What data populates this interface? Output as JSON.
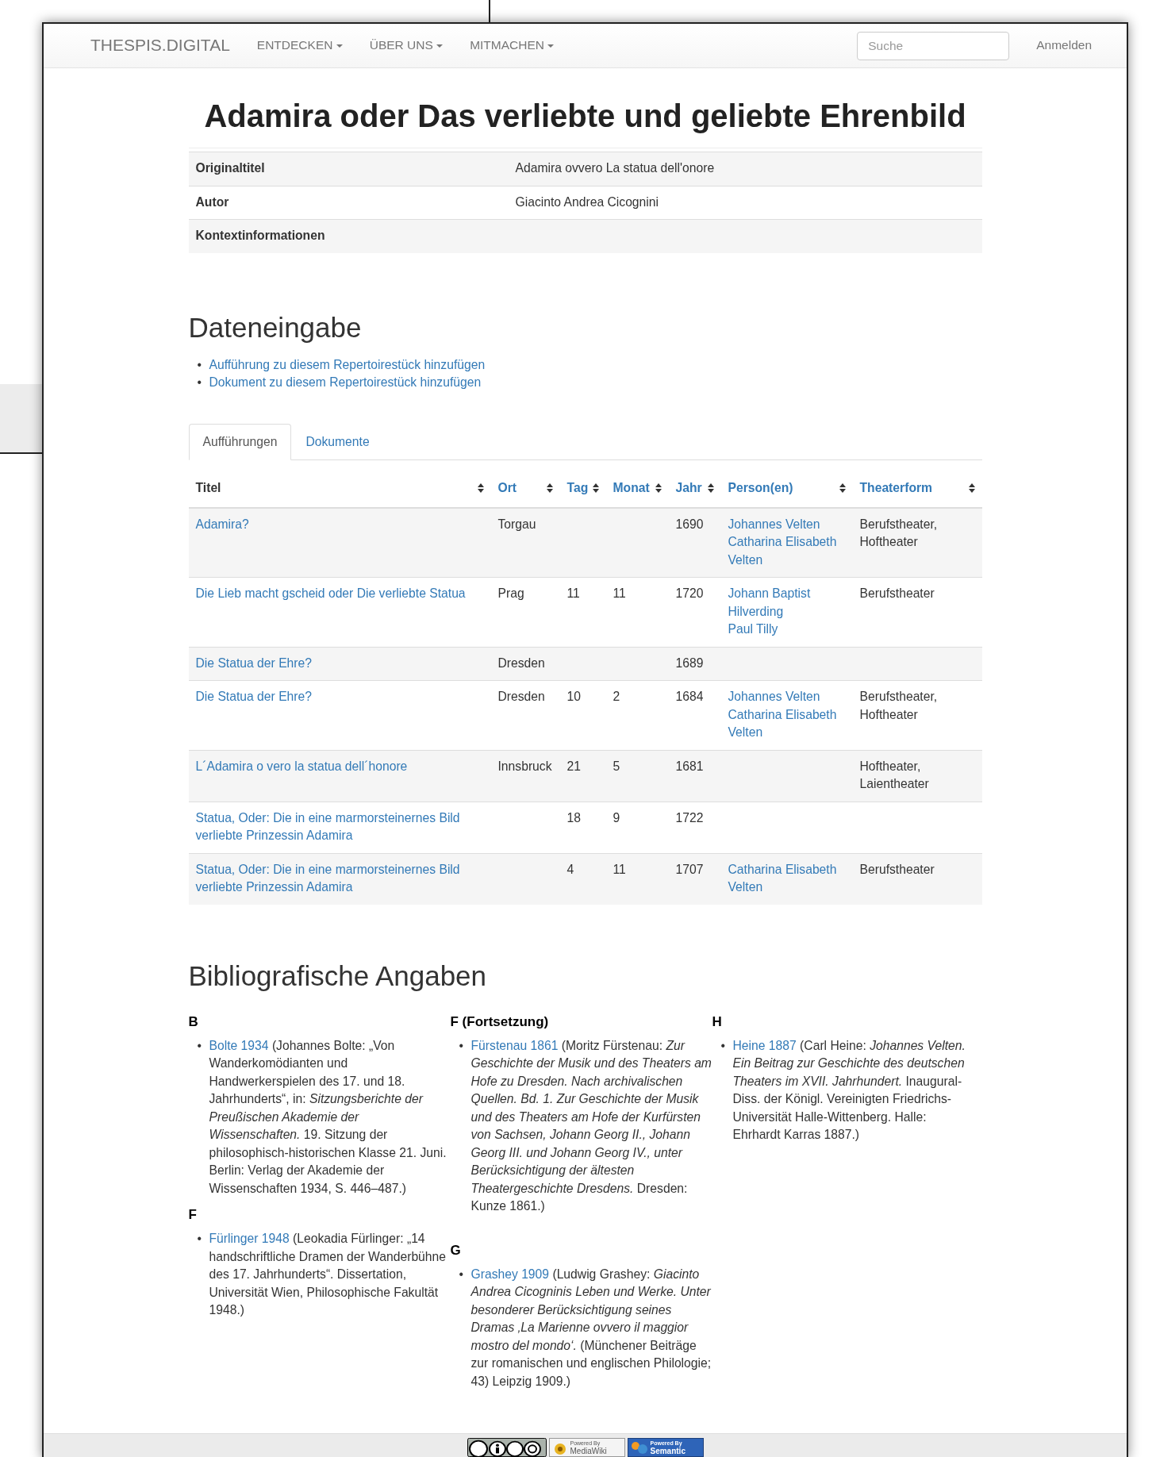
{
  "navbar": {
    "brand": "THESPIS.DIGITAL",
    "menus": [
      {
        "label": "ENTDECKEN"
      },
      {
        "label": "ÜBER UNS"
      },
      {
        "label": "MITMACHEN"
      }
    ],
    "search": {
      "placeholder": "Suche"
    },
    "login": "Anmelden"
  },
  "title": "Adamira oder Das verliebte und geliebte Ehrenbild",
  "info": [
    {
      "label": "Originaltitel",
      "value": "Adamira ovvero La statua dell'onore"
    },
    {
      "label": "Autor",
      "value": "Giacinto Andrea Cicognini"
    },
    {
      "label": "Kontextinformationen"
    }
  ],
  "data_entry": {
    "heading": "Dateneingabe",
    "links": [
      {
        "bullet": "•",
        "label": "Aufführung zu diesem Repertoirestück hinzufügen"
      },
      {
        "bullet": "•",
        "label": "Dokument zu diesem Repertoirestück hinzufügen"
      }
    ]
  },
  "tabs": [
    {
      "label": "Aufführungen",
      "selected": true
    },
    {
      "label": "Dokumente",
      "selected": false
    }
  ],
  "table": {
    "columns": [
      {
        "label": "Titel",
        "kind": "plain"
      },
      {
        "label": "Ort",
        "kind": "link"
      },
      {
        "label": "Tag",
        "kind": "link"
      },
      {
        "label": "Monat",
        "kind": "link"
      },
      {
        "label": "Jahr",
        "kind": "link"
      },
      {
        "label": "Person(en)",
        "kind": "link"
      },
      {
        "label": "Theaterform",
        "kind": "link"
      }
    ],
    "rows": [
      {
        "titel": "Adamira?",
        "ort": "Torgau",
        "tag": "",
        "monat": "",
        "jahr": "1690",
        "persons": [
          "Johannes Velten",
          "Catharina Elisabeth Velten"
        ],
        "theaterform": "Berufstheater, Hoftheater"
      },
      {
        "titel": "Die Lieb macht gscheid oder Die verliebte Statua",
        "ort": "Prag",
        "tag": "11",
        "monat": "11",
        "jahr": "1720",
        "persons": [
          "Johann Baptist Hilverding",
          "Paul Tilly"
        ],
        "theaterform": "Berufstheater"
      },
      {
        "titel": "Die Statua der Ehre?",
        "ort": "Dresden",
        "tag": "",
        "monat": "",
        "jahr": "1689",
        "persons": [],
        "theaterform": ""
      },
      {
        "titel": "Die Statua der Ehre?",
        "ort": "Dresden",
        "tag": "10",
        "monat": "2",
        "jahr": "1684",
        "persons": [
          "Johannes Velten",
          "Catharina Elisabeth Velten"
        ],
        "theaterform": "Berufstheater, Hoftheater"
      },
      {
        "titel": "L´Adamira o vero la statua dell´honore",
        "ort": "Innsbruck",
        "tag": "21",
        "monat": "5",
        "jahr": "1681",
        "persons": [],
        "theaterform": "Hoftheater, Laientheater"
      },
      {
        "titel": "Statua, Oder: Die in eine marmorsteinernes Bild verliebte Prinzessin Adamira",
        "ort": "",
        "tag": "18",
        "monat": "9",
        "jahr": "1722",
        "persons": [],
        "theaterform": ""
      },
      {
        "titel": "Statua, Oder: Die in eine marmorsteinernes Bild verliebte Prinzessin Adamira",
        "ort": "",
        "tag": "4",
        "monat": "11",
        "jahr": "1707",
        "persons": [
          "Catharina Elisabeth Velten"
        ],
        "theaterform": "Berufstheater"
      }
    ]
  },
  "bibliography": {
    "heading": "Bibliografische Angaben",
    "columns": [
      [
        {
          "heading": "B",
          "entries": [
            {
              "bullet": "•",
              "link": "Bolte 1934",
              "text": "(Johannes Bolte: „Von Wanderkomödianten und Handwerkerspielen des 17. und 18. Jahrhunderts“, in: *Sitzungsberichte der Preußischen Akademie der Wissenschaften.* 19. Sitzung der philosophisch-historischen Klasse 21. Juni. Berlin: Verlag der Akademie der Wissenschaften 1934, S. 446–487.)"
            }
          ]
        },
        {
          "heading": "F",
          "entries": [
            {
              "bullet": "•",
              "link": "Fürlinger 1948",
              "text": "(Leokadia Fürlinger: „14 handschriftliche Dramen der Wanderbühne des 17. Jahrhunderts“. Dissertation, Universität Wien, Philosophische Fakultät 1948.)"
            }
          ]
        }
      ],
      [
        {
          "heading": "F (Fortsetzung)",
          "entries": [
            {
              "bullet": "•",
              "link": "Fürstenau 1861",
              "text": "(Moritz Fürstenau: *Zur Geschichte der Musik und des Theaters am Hofe zu Dresden. Nach archivalischen Quellen. Bd. 1. Zur Geschichte der Musik und des Theaters am Hofe der Kurfürsten von Sachsen, Johann Georg II., Johann Georg III. und Johann Georg IV., unter Berücksichtigung der ältesten Theatergeschichte Dresdens.* Dresden: Kunze 1861.)"
            }
          ]
        },
        {
          "heading": "G",
          "entries": [
            {
              "bullet": "•",
              "link": "Grashey 1909",
              "text": "(Ludwig Grashey: *Giacinto Andrea Cicogninis Leben und Werke. Unter besonderer Berücksichtigung seines Dramas ‚La Marienne ovvero il maggior mostro del mondo‘.* (Münchener Beiträge zur romanischen und englischen Philologie; 43) Leipzig 1909.)"
            }
          ]
        }
      ],
      [
        {
          "heading": "H",
          "entries": [
            {
              "bullet": "•",
              "link": "Heine 1887",
              "text": "(Carl Heine: *Johannes Velten. Ein Beitrag zur Geschichte des deutschen Theaters im XVII. Jahrhundert.* Inaugural-Diss. der Königl. Vereinigten Friedrichs-Universität Halle-Wittenberg. Halle: Ehrhardt Karras 1887.)"
            }
          ]
        }
      ]
    ]
  },
  "footer": {
    "badges": [
      {
        "kind": "cc"
      },
      {
        "kind": "mediawiki",
        "lines": [
          "Powered By",
          "MediaWiki"
        ]
      },
      {
        "kind": "semantic",
        "lines": [
          "Powered By",
          "Semantic"
        ]
      }
    ]
  }
}
